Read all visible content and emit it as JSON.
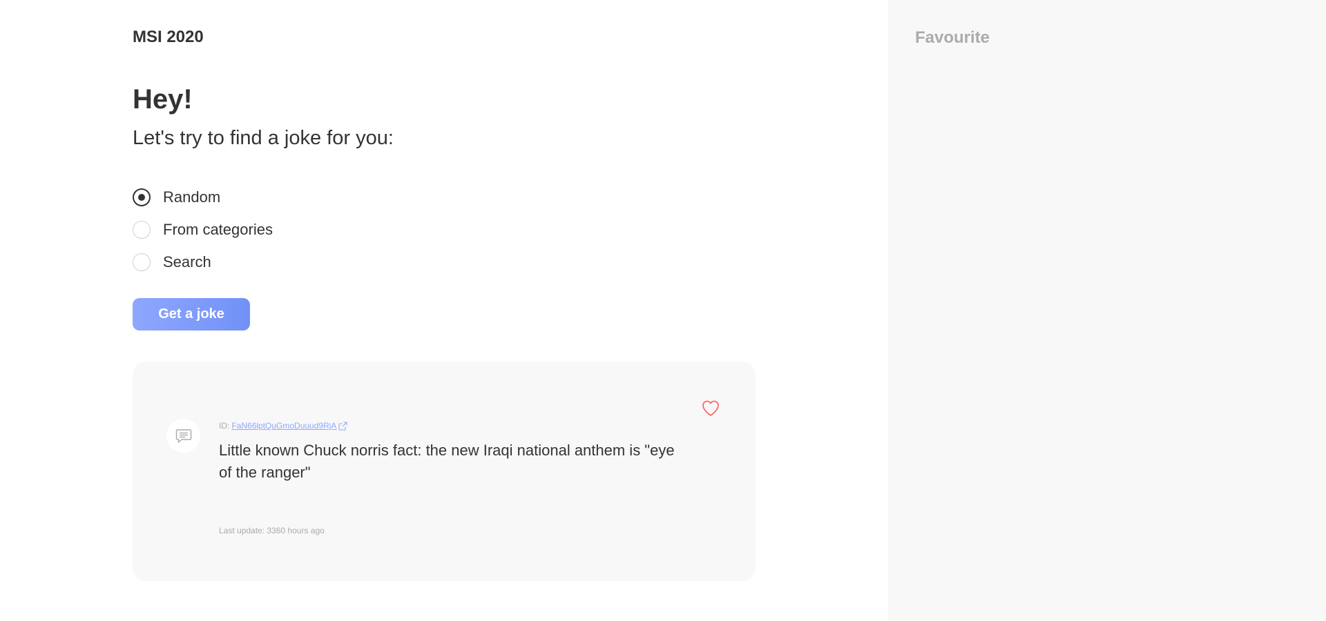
{
  "header": {
    "brand": "MSI 2020"
  },
  "main": {
    "greeting": "Hey!",
    "subtitle": "Let's try to find a joke for you:",
    "options": [
      {
        "label": "Random",
        "checked": true
      },
      {
        "label": "From categories",
        "checked": false
      },
      {
        "label": "Search",
        "checked": false
      }
    ],
    "get_joke_label": "Get a joke"
  },
  "joke": {
    "id_prefix": "ID:",
    "id_value": "FaN66lptQuGmoDuuud9RjA",
    "text": "Little known Chuck norris fact: the new Iraqi national anthem is \"eye of the ranger\"",
    "last_update": "Last update: 3360 hours ago",
    "icons": {
      "message": "message-icon",
      "favorite": "heart-icon",
      "external_link": "external-link-icon"
    }
  },
  "sidebar": {
    "title": "Favourite"
  },
  "colors": {
    "accent": "#8EA7FF",
    "accent_dark": "#7291F7",
    "heart": "#FF6767",
    "sidebar_bg": "#F8F8F8",
    "card_bg": "#F8F8F8",
    "text": "#333333",
    "muted": "#ABABAB"
  }
}
